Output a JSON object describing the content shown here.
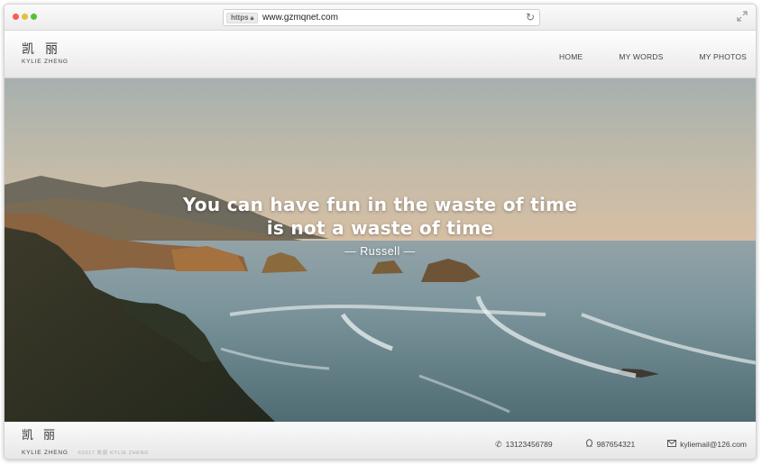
{
  "browser": {
    "scheme_badge": "https",
    "url": "www.gzmqnet.com"
  },
  "header": {
    "logo_cn": "凯丽",
    "logo_en": "KYLIE ZHENG",
    "nav": [
      "HOME",
      "MY WORDS",
      "MY PHOTOS"
    ]
  },
  "hero": {
    "quote_line_1": "You can have fun in the waste of time",
    "quote_line_2": "is not a waste of time",
    "author": "Russell",
    "author_dash": "—"
  },
  "footer": {
    "logo_cn": "凯丽",
    "logo_en": "KYLIE ZHENG",
    "copyright": "©2017 凯丽 KYLIE ZHENG",
    "phone": "13123456789",
    "qq": "987654321",
    "email": "kyliemail@126.com"
  },
  "icons": {
    "lock": "lock-icon",
    "reload": "reload-icon",
    "expand": "expand-icon",
    "phone": "phone-icon",
    "qq": "qq-penguin-icon",
    "email": "envelope-icon"
  },
  "colors": {
    "traffic_red": "#fc5b57",
    "traffic_yellow": "#e5bf3c",
    "traffic_green": "#57c038",
    "hero_text": "#ffffff"
  }
}
